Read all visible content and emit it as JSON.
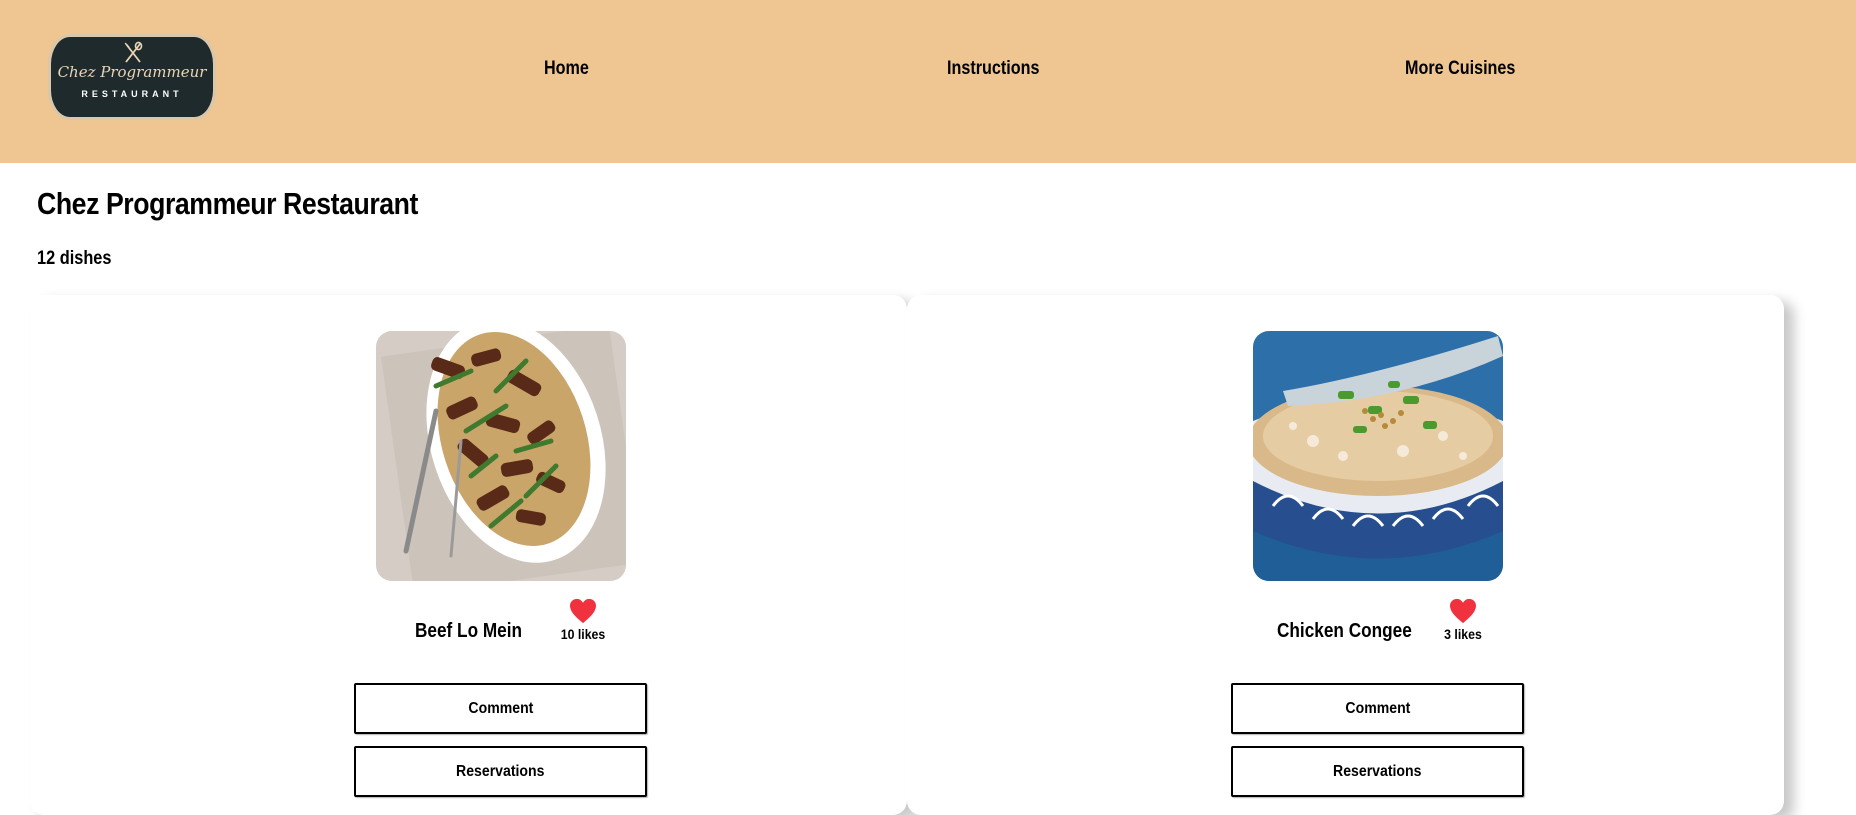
{
  "header": {
    "logo": {
      "script_text": "Chez Programmeur",
      "sub_text": "RESTAURANT",
      "icon": "fork-spoon-icon"
    },
    "nav": [
      {
        "label": "Home"
      },
      {
        "label": "Instructions"
      },
      {
        "label": "More Cuisines"
      }
    ],
    "background": "#efc592"
  },
  "main": {
    "title": "Chez Programmeur Restaurant",
    "dish_count": "12 dishes"
  },
  "dishes": [
    {
      "name": "Beef Lo Mein",
      "likes": "10 likes",
      "comment_label": "Comment",
      "reservations_label": "Reservations",
      "image": "beef-lo-mein-photo"
    },
    {
      "name": "Chicken Congee",
      "likes": "3 likes",
      "comment_label": "Comment",
      "reservations_label": "Reservations",
      "image": "chicken-congee-photo"
    }
  ],
  "colors": {
    "heart": "#f0323f",
    "header": "#efc592"
  }
}
